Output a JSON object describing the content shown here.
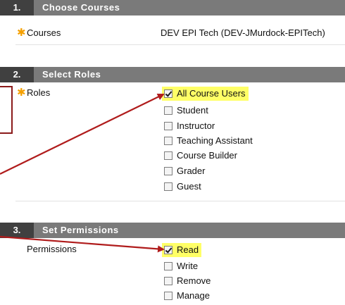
{
  "sections": [
    {
      "number": "1.",
      "title": "Choose Courses"
    },
    {
      "number": "2.",
      "title": "Select Roles"
    },
    {
      "number": "3.",
      "title": "Set Permissions"
    }
  ],
  "courses": {
    "label": "Courses",
    "value": "DEV EPI Tech (DEV-JMurdock-EPITech)"
  },
  "roles": {
    "label": "Roles",
    "options": [
      {
        "label": "All Course Users",
        "checked": true,
        "highlighted": true
      },
      {
        "label": "Student",
        "checked": false,
        "highlighted": false
      },
      {
        "label": "Instructor",
        "checked": false,
        "highlighted": false
      },
      {
        "label": "Teaching Assistant",
        "checked": false,
        "highlighted": false
      },
      {
        "label": "Course Builder",
        "checked": false,
        "highlighted": false
      },
      {
        "label": "Grader",
        "checked": false,
        "highlighted": false
      },
      {
        "label": "Guest",
        "checked": false,
        "highlighted": false
      }
    ]
  },
  "permissions": {
    "label": "Permissions",
    "options": [
      {
        "label": "Read",
        "checked": true,
        "highlighted": true
      },
      {
        "label": "Write",
        "checked": false,
        "highlighted": false
      },
      {
        "label": "Remove",
        "checked": false,
        "highlighted": false
      },
      {
        "label": "Manage",
        "checked": false,
        "highlighted": false
      }
    ]
  },
  "icons": {
    "required": "asterisk-icon",
    "check": "check-icon"
  },
  "colors": {
    "header_bg": "#7a7a7a",
    "step_number_bg": "#404040",
    "required": "#f5a000",
    "highlight": "#ffff66",
    "annotation": "#b01c1c"
  }
}
